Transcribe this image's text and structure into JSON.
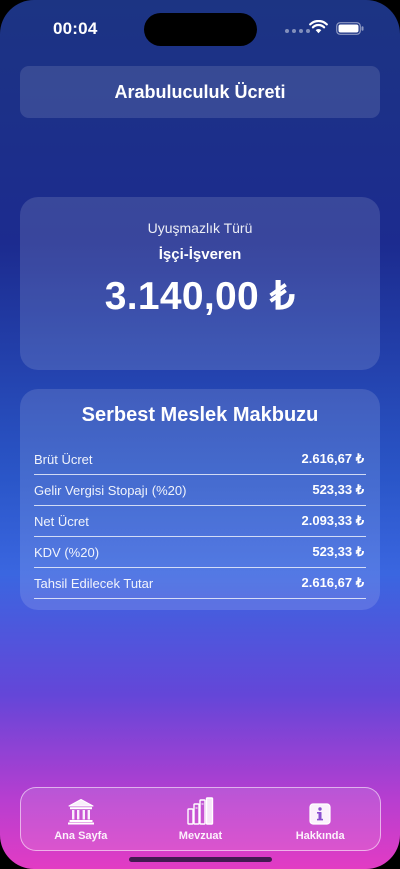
{
  "status_bar": {
    "time": "00:04"
  },
  "header": {
    "title": "Arabuluculuk Ücreti"
  },
  "fee_card": {
    "dispute_type_label": "Uyuşmazlık Türü",
    "dispute_type_value": "İşçi-İşveren",
    "amount": "3.140,00 ₺"
  },
  "receipt": {
    "title": "Serbest Meslek Makbuzu",
    "rows": [
      {
        "label": "Brüt Ücret",
        "value": "2.616,67 ₺"
      },
      {
        "label": "Gelir Vergisi Stopajı (%20)",
        "value": "523,33 ₺"
      },
      {
        "label": "Net Ücret",
        "value": "2.093,33 ₺"
      },
      {
        "label": "KDV (%20)",
        "value": "523,33 ₺"
      },
      {
        "label": "Tahsil Edilecek Tutar",
        "value": "2.616,67 ₺"
      }
    ]
  },
  "tab_bar": {
    "tabs": [
      {
        "label": "Ana Sayfa",
        "icon": "courthouse-icon"
      },
      {
        "label": "Mevzuat",
        "icon": "books-icon"
      },
      {
        "label": "Hakkında",
        "icon": "info-icon"
      }
    ]
  }
}
